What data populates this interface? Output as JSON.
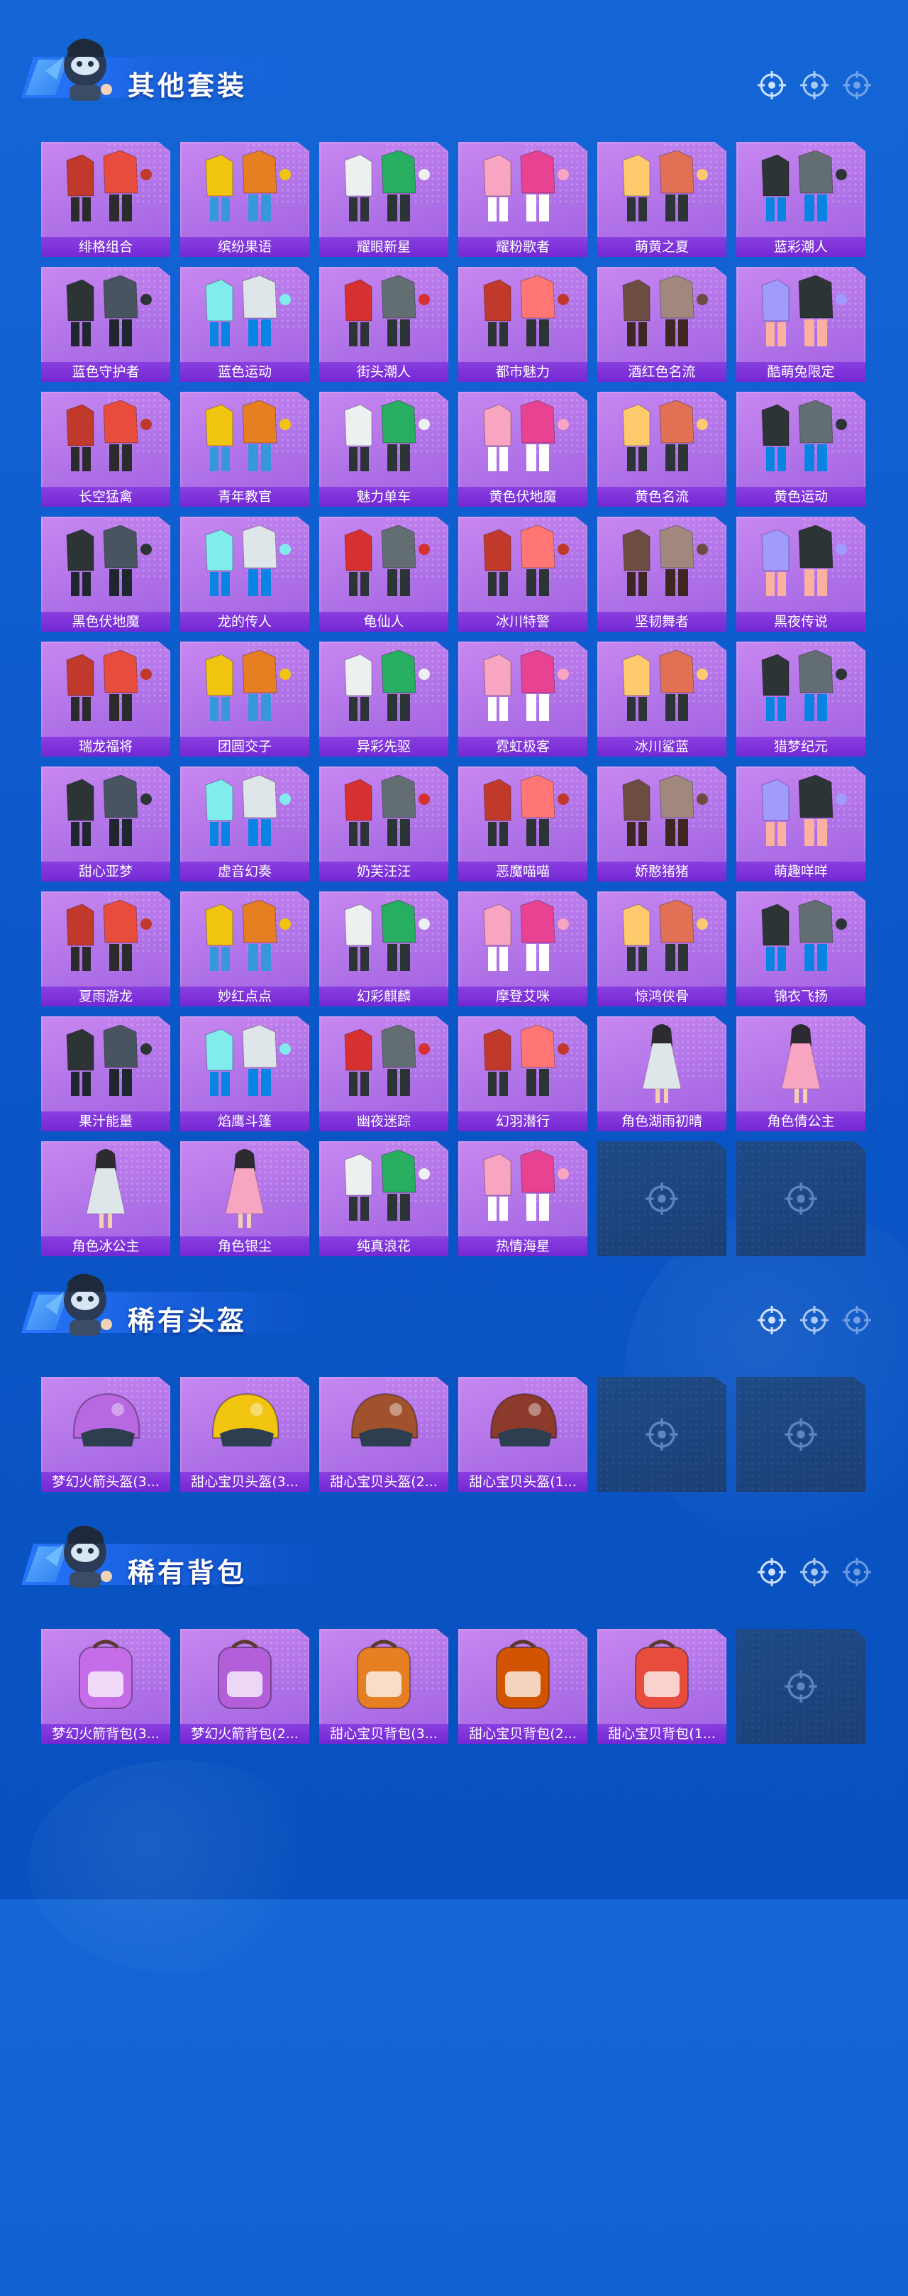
{
  "colors": {
    "background": "#1466d6",
    "card": "#b274e8",
    "card_label": "#7a2fd6",
    "empty_slot": "#1d4680",
    "title_text": "#ffffff"
  },
  "sections": [
    {
      "title": "其他套装",
      "columns": 6,
      "total_slots": 54,
      "items": [
        {
          "label": "绯格组合",
          "icon": "outfit-icon"
        },
        {
          "label": "缤纷果语",
          "icon": "outfit-icon"
        },
        {
          "label": "耀眼新星",
          "icon": "outfit-icon"
        },
        {
          "label": "耀粉歌者",
          "icon": "outfit-icon"
        },
        {
          "label": "萌黄之夏",
          "icon": "outfit-icon"
        },
        {
          "label": "蓝彩潮人",
          "icon": "outfit-icon"
        },
        {
          "label": "蓝色守护者",
          "icon": "outfit-icon"
        },
        {
          "label": "蓝色运动",
          "icon": "outfit-icon"
        },
        {
          "label": "街头潮人",
          "icon": "outfit-icon"
        },
        {
          "label": "都市魅力",
          "icon": "outfit-icon"
        },
        {
          "label": "酒红色名流",
          "icon": "outfit-icon"
        },
        {
          "label": "酷萌兔限定",
          "icon": "outfit-icon"
        },
        {
          "label": "长空猛禽",
          "icon": "outfit-icon"
        },
        {
          "label": "青年教官",
          "icon": "outfit-icon"
        },
        {
          "label": "魅力单车",
          "icon": "outfit-icon"
        },
        {
          "label": "黄色伏地魔",
          "icon": "outfit-icon"
        },
        {
          "label": "黄色名流",
          "icon": "outfit-icon"
        },
        {
          "label": "黄色运动",
          "icon": "outfit-icon"
        },
        {
          "label": "黑色伏地魔",
          "icon": "outfit-icon"
        },
        {
          "label": "龙的传人",
          "icon": "outfit-icon"
        },
        {
          "label": "龟仙人",
          "icon": "outfit-icon"
        },
        {
          "label": "冰川特警",
          "icon": "outfit-icon"
        },
        {
          "label": "坚韧舞者",
          "icon": "outfit-icon"
        },
        {
          "label": "黑夜传说",
          "icon": "outfit-icon"
        },
        {
          "label": "瑞龙福将",
          "icon": "outfit-icon"
        },
        {
          "label": "团圆交子",
          "icon": "outfit-icon"
        },
        {
          "label": "异彩先驱",
          "icon": "outfit-icon"
        },
        {
          "label": "霓虹极客",
          "icon": "outfit-icon"
        },
        {
          "label": "冰川鲨蓝",
          "icon": "outfit-icon"
        },
        {
          "label": "猎梦纪元",
          "icon": "outfit-icon"
        },
        {
          "label": "甜心亚梦",
          "icon": "outfit-icon"
        },
        {
          "label": "虚音幻奏",
          "icon": "outfit-icon"
        },
        {
          "label": "奶芙汪汪",
          "icon": "outfit-icon"
        },
        {
          "label": "恶魔喵喵",
          "icon": "outfit-icon"
        },
        {
          "label": "娇憨猪猪",
          "icon": "outfit-icon"
        },
        {
          "label": "萌趣咩咩",
          "icon": "outfit-icon"
        },
        {
          "label": "夏雨游龙",
          "icon": "outfit-icon"
        },
        {
          "label": "妙红点点",
          "icon": "outfit-icon"
        },
        {
          "label": "幻彩麒麟",
          "icon": "outfit-icon"
        },
        {
          "label": "摩登艾咪",
          "icon": "outfit-icon"
        },
        {
          "label": "惊鸿侠骨",
          "icon": "outfit-icon"
        },
        {
          "label": "锦衣飞扬",
          "icon": "outfit-icon"
        },
        {
          "label": "果汁能量",
          "icon": "outfit-icon"
        },
        {
          "label": "焰鹰斗篷",
          "icon": "outfit-icon"
        },
        {
          "label": "幽夜迷踪",
          "icon": "outfit-icon"
        },
        {
          "label": "幻羽潜行",
          "icon": "outfit-icon"
        },
        {
          "label": "角色湖雨初晴",
          "icon": "character-icon"
        },
        {
          "label": "角色倩公主",
          "icon": "character-icon"
        },
        {
          "label": "角色冰公主",
          "icon": "character-icon"
        },
        {
          "label": "角色银尘",
          "icon": "character-icon"
        },
        {
          "label": "纯真浪花",
          "icon": "outfit-icon"
        },
        {
          "label": "热情海星",
          "icon": "outfit-icon"
        }
      ]
    },
    {
      "title": "稀有头盔",
      "columns": 6,
      "total_slots": 6,
      "items": [
        {
          "label": "梦幻火箭头盔(3...",
          "icon": "helmet-icon"
        },
        {
          "label": "甜心宝贝头盔(3...",
          "icon": "helmet-icon"
        },
        {
          "label": "甜心宝贝头盔(2...",
          "icon": "helmet-icon"
        },
        {
          "label": "甜心宝贝头盔(1...",
          "icon": "helmet-icon"
        }
      ]
    },
    {
      "title": "稀有背包",
      "columns": 6,
      "total_slots": 6,
      "items": [
        {
          "label": "梦幻火箭背包(3...",
          "icon": "backpack-icon"
        },
        {
          "label": "梦幻火箭背包(2...",
          "icon": "backpack-icon"
        },
        {
          "label": "甜心宝贝背包(3...",
          "icon": "backpack-icon"
        },
        {
          "label": "甜心宝贝背包(2...",
          "icon": "backpack-icon"
        },
        {
          "label": "甜心宝贝背包(1...",
          "icon": "backpack-icon"
        }
      ]
    }
  ]
}
